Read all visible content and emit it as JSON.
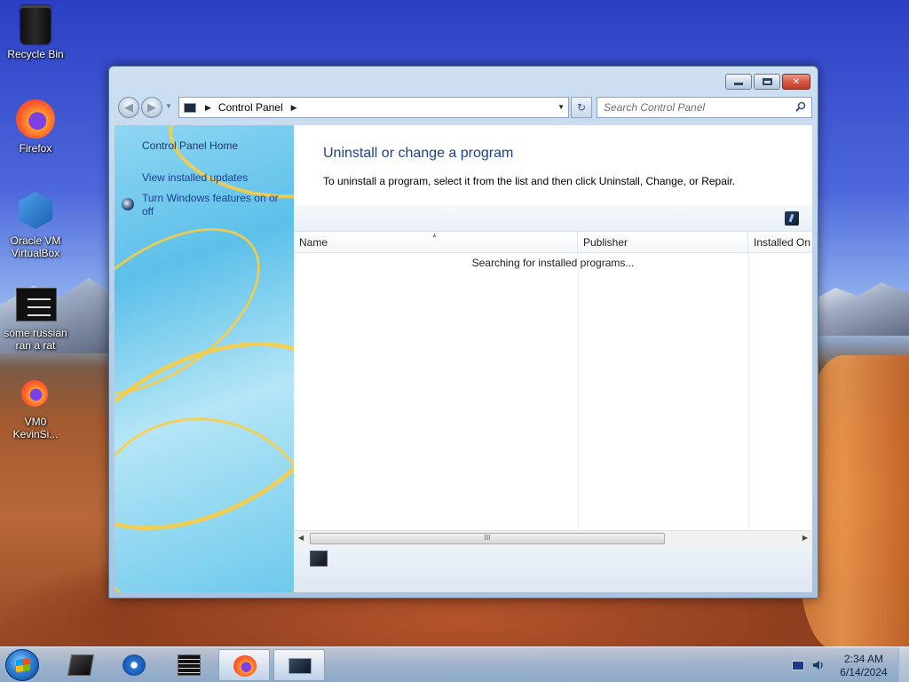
{
  "desktop": {
    "icons": [
      {
        "label": "Recycle Bin",
        "icon": "recycle-bin-icon"
      },
      {
        "label": "Firefox",
        "icon": "firefox-icon"
      },
      {
        "label": "Oracle VM VirtualBox",
        "icon": "virtualbox-icon"
      },
      {
        "label": "some russian ran a rat",
        "icon": "terminal-icon"
      },
      {
        "label": "VM0 KevinSi...",
        "icon": "firefox-shortcut-icon"
      }
    ]
  },
  "window": {
    "controls": {
      "minimize": "minimize",
      "maximize": "maximize",
      "close": "✕"
    },
    "nav": {
      "back": "◀",
      "forward": "▶"
    },
    "address": {
      "segment": "Control Panel",
      "separator": "▶"
    },
    "search": {
      "placeholder": "Search Control Panel"
    },
    "sidebar": {
      "home": "Control Panel Home",
      "links": [
        "View installed updates",
        "Turn Windows features on or off"
      ]
    },
    "content": {
      "title": "Uninstall or change a program",
      "description": "To uninstall a program, select it from the list and then click Uninstall, Change, or Repair.",
      "columns": [
        "Name",
        "Publisher",
        "Installed On"
      ],
      "status": "Searching for installed programs...",
      "scroll_thumb": "III"
    }
  },
  "taskbar": {
    "items": [
      "start-orb",
      "file-manager",
      "media-player",
      "terminal",
      "firefox",
      "control-panel"
    ],
    "active": "firefox",
    "clock": {
      "time": "2:34 AM",
      "date": "6/14/2024"
    }
  },
  "colors": {
    "link": "#1c3f8e",
    "title": "#1e3f8f",
    "close_button": "#c0392b"
  }
}
